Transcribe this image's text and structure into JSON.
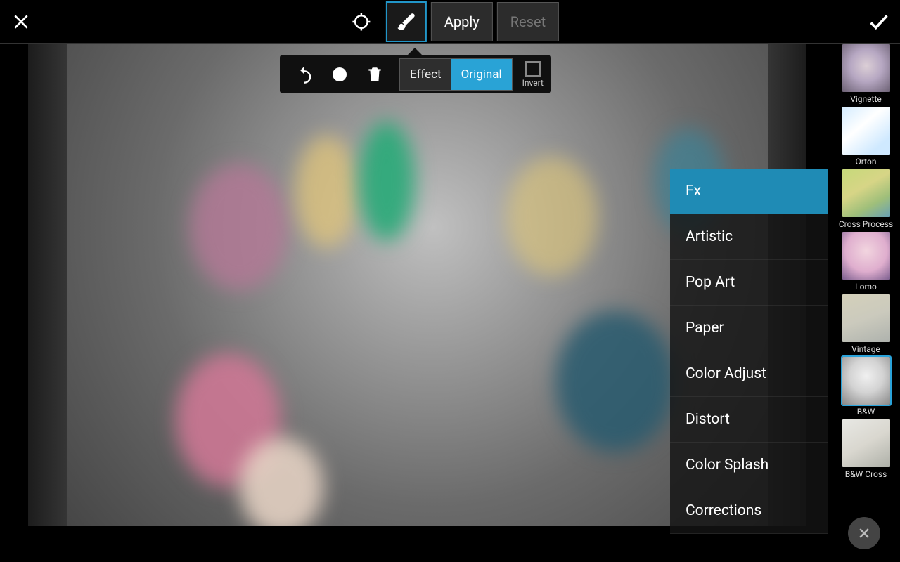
{
  "topbar": {
    "apply_label": "Apply",
    "reset_label": "Reset"
  },
  "brush_popup": {
    "effect_label": "Effect",
    "original_label": "Original",
    "invert_label": "Invert"
  },
  "fx_menu": {
    "items": [
      {
        "label": "Fx",
        "selected": true
      },
      {
        "label": "Artistic"
      },
      {
        "label": "Pop Art"
      },
      {
        "label": "Paper"
      },
      {
        "label": "Color Adjust"
      },
      {
        "label": "Distort"
      },
      {
        "label": "Color Splash"
      },
      {
        "label": "Corrections"
      }
    ]
  },
  "presets": [
    {
      "label": "Vignette",
      "thumb_class": "th-vig"
    },
    {
      "label": "Orton",
      "thumb_class": "th-ort"
    },
    {
      "label": "Cross Process",
      "thumb_class": "th-cro"
    },
    {
      "label": "Lomo",
      "thumb_class": "th-lom"
    },
    {
      "label": "Vintage",
      "thumb_class": "th-vin"
    },
    {
      "label": "B&W",
      "thumb_class": "th-bw",
      "selected": true
    },
    {
      "label": "B&W Cross",
      "thumb_class": "th-bwc"
    }
  ]
}
